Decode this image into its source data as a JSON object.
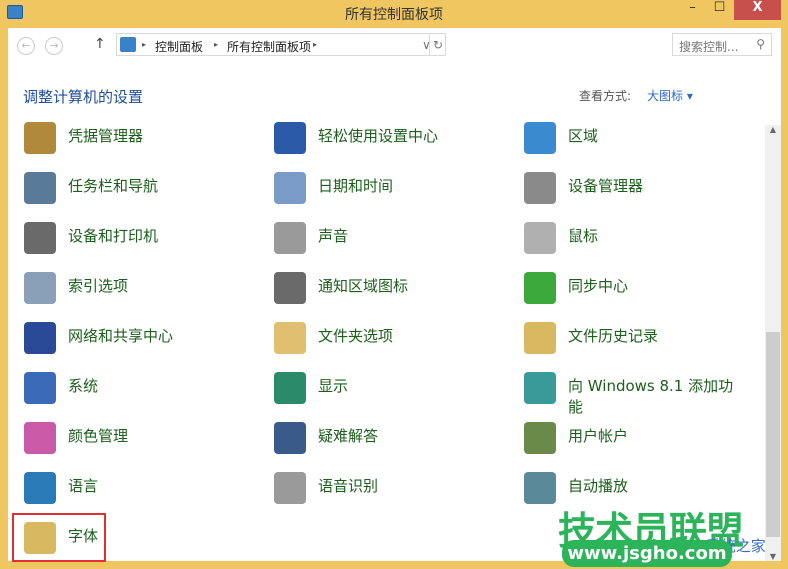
{
  "window": {
    "title": "所有控制面板项",
    "minimize": "–",
    "maximize": "☐",
    "close": "X"
  },
  "address": {
    "crumbs": [
      "控制面板",
      "所有控制面板项"
    ],
    "separator": "▸",
    "search_placeholder": "搜索控制...",
    "back": "←",
    "forward": "→",
    "up": "↑",
    "refresh": "↻",
    "dropdown": "∨"
  },
  "header": {
    "title": "调整计算机的设置",
    "view_label": "查看方式:",
    "view_value": "大图标 ▾"
  },
  "items": [
    {
      "label": "凭据管理器",
      "icon": "credential-vault-icon",
      "color": "#b08a3a"
    },
    {
      "label": "轻松使用设置中心",
      "icon": "ease-of-access-icon",
      "color": "#2a5aa8"
    },
    {
      "label": "区域",
      "icon": "globe-clock-icon",
      "color": "#3a8ad0"
    },
    {
      "label": "任务栏和导航",
      "icon": "taskbar-icon",
      "color": "#5a7a9a"
    },
    {
      "label": "日期和时间",
      "icon": "calendar-clock-icon",
      "color": "#7a9ac8"
    },
    {
      "label": "设备管理器",
      "icon": "device-manager-icon",
      "color": "#8a8a8a"
    },
    {
      "label": "设备和打印机",
      "icon": "printer-icon",
      "color": "#6a6a6a"
    },
    {
      "label": "声音",
      "icon": "speaker-icon",
      "color": "#9a9a9a"
    },
    {
      "label": "鼠标",
      "icon": "mouse-icon",
      "color": "#b0b0b0"
    },
    {
      "label": "索引选项",
      "icon": "magnifier-icon",
      "color": "#8aa0b8"
    },
    {
      "label": "通知区域图标",
      "icon": "notification-area-icon",
      "color": "#6a6a6a"
    },
    {
      "label": "同步中心",
      "icon": "sync-icon",
      "color": "#3aa83a"
    },
    {
      "label": "网络和共享中心",
      "icon": "network-icon",
      "color": "#2a4a98"
    },
    {
      "label": "文件夹选项",
      "icon": "folder-options-icon",
      "color": "#e0c070"
    },
    {
      "label": "文件历史记录",
      "icon": "file-history-icon",
      "color": "#d8b860"
    },
    {
      "label": "系统",
      "icon": "computer-icon",
      "color": "#3a6ab8"
    },
    {
      "label": "显示",
      "icon": "display-icon",
      "color": "#2a8a6a"
    },
    {
      "label": "向 Windows 8.1 添加功能",
      "icon": "add-features-icon",
      "color": "#3a9a9a"
    },
    {
      "label": "颜色管理",
      "icon": "color-management-icon",
      "color": "#c85aa8"
    },
    {
      "label": "疑难解答",
      "icon": "troubleshooting-icon",
      "color": "#3a5a8a"
    },
    {
      "label": "用户帐户",
      "icon": "user-accounts-icon",
      "color": "#6a8a4a"
    },
    {
      "label": "语言",
      "icon": "language-icon",
      "color": "#2a7ab8"
    },
    {
      "label": "语音识别",
      "icon": "microphone-icon",
      "color": "#9a9a9a"
    },
    {
      "label": "自动播放",
      "icon": "autoplay-icon",
      "color": "#5a8a9a"
    },
    {
      "label": "字体",
      "icon": "fonts-icon",
      "color": "#d8b860"
    }
  ],
  "watermark": {
    "brand": "技术员联盟",
    "url": "www.jsgho.com",
    "sub": "Win8系统之家"
  }
}
